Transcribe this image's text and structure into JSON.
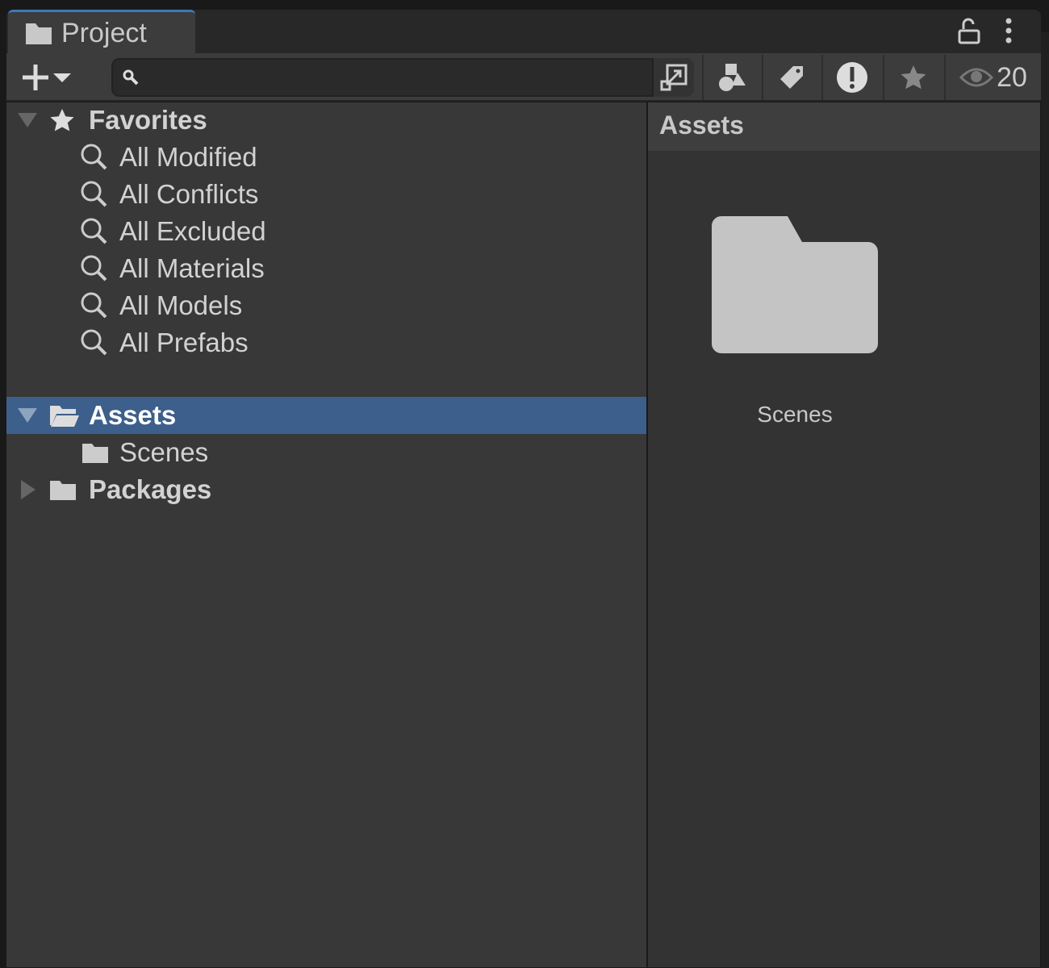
{
  "tab": {
    "title": "Project"
  },
  "toolbar": {
    "search_placeholder": "",
    "visible_count": "20"
  },
  "favorites": {
    "label": "Favorites",
    "items": [
      "All Modified",
      "All Conflicts",
      "All Excluded",
      "All Materials",
      "All Models",
      "All Prefabs"
    ]
  },
  "tree": {
    "assets": "Assets",
    "scenes": "Scenes",
    "packages": "Packages"
  },
  "content": {
    "breadcrumb": "Assets",
    "items": [
      {
        "name": "Scenes"
      }
    ]
  },
  "colors": {
    "selection": "#3d5f8b",
    "tab_accent": "#3a79bb"
  }
}
